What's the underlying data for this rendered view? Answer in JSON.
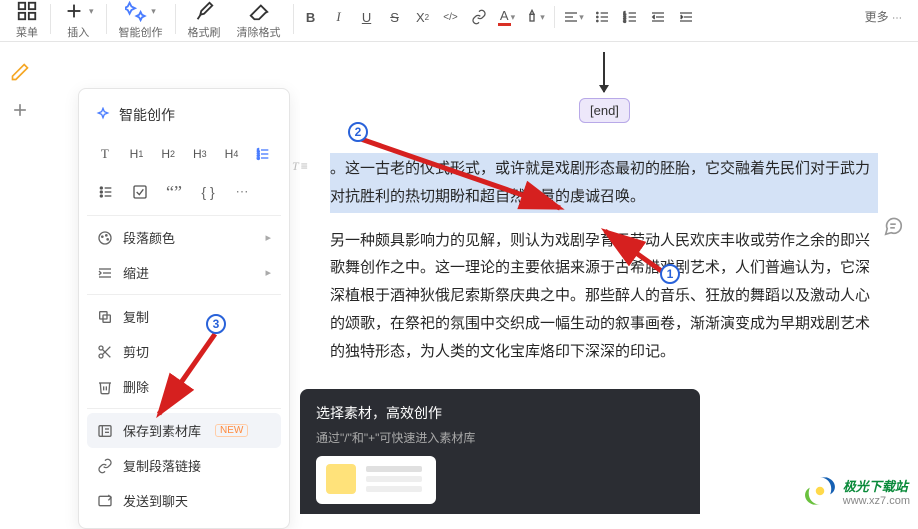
{
  "toolbar": {
    "menu": "菜单",
    "insert": "插入",
    "smart": "智能创作",
    "format_painter": "格式刷",
    "clear_format": "清除格式",
    "more": "更多"
  },
  "smart_panel": {
    "title": "智能创作",
    "headings": [
      "T",
      "H1",
      "H2",
      "H3",
      "H4"
    ],
    "items": {
      "paragraph_color": "段落颜色",
      "indent": "缩进",
      "copy": "复制",
      "cut": "剪切",
      "delete": "删除",
      "save_to_lib": "保存到素材库",
      "save_new_tag": "NEW",
      "copy_link": "复制段落链接",
      "send_chat": "发送到聊天"
    }
  },
  "doc": {
    "end_label": "[end]",
    "para1": "。这一古老的仪式形式，或许就是戏剧形态最初的胚胎，它交融着先民们对于武力对抗胜利的热切期盼和超自然力量的虔诚召唤。",
    "para2": "另一种颇具影响力的见解，则认为戏剧孕育于劳动人民欢庆丰收或劳作之余的即兴歌舞创作之中。这一理论的主要依据来源于古希腊戏剧艺术，人们普遍认为，它深深植根于酒神狄俄尼索斯祭庆典之中。那些醉人的音乐、狂放的舞蹈以及激动人心的颂歌，在祭祀的氛围中交织成一幅生动的叙事画卷，渐渐演变成为早期戏剧艺术的独特形态，为人类的文化宝库烙印下深深的印记。"
  },
  "popup": {
    "title": "选择素材，高效创作",
    "sub": "通过\"/\"和\"+\"可快速进入素材库"
  },
  "annotations": {
    "b1": "1",
    "b2": "2",
    "b3": "3"
  },
  "watermark": {
    "name": "极光下载站",
    "url": "www.xz7.com"
  }
}
